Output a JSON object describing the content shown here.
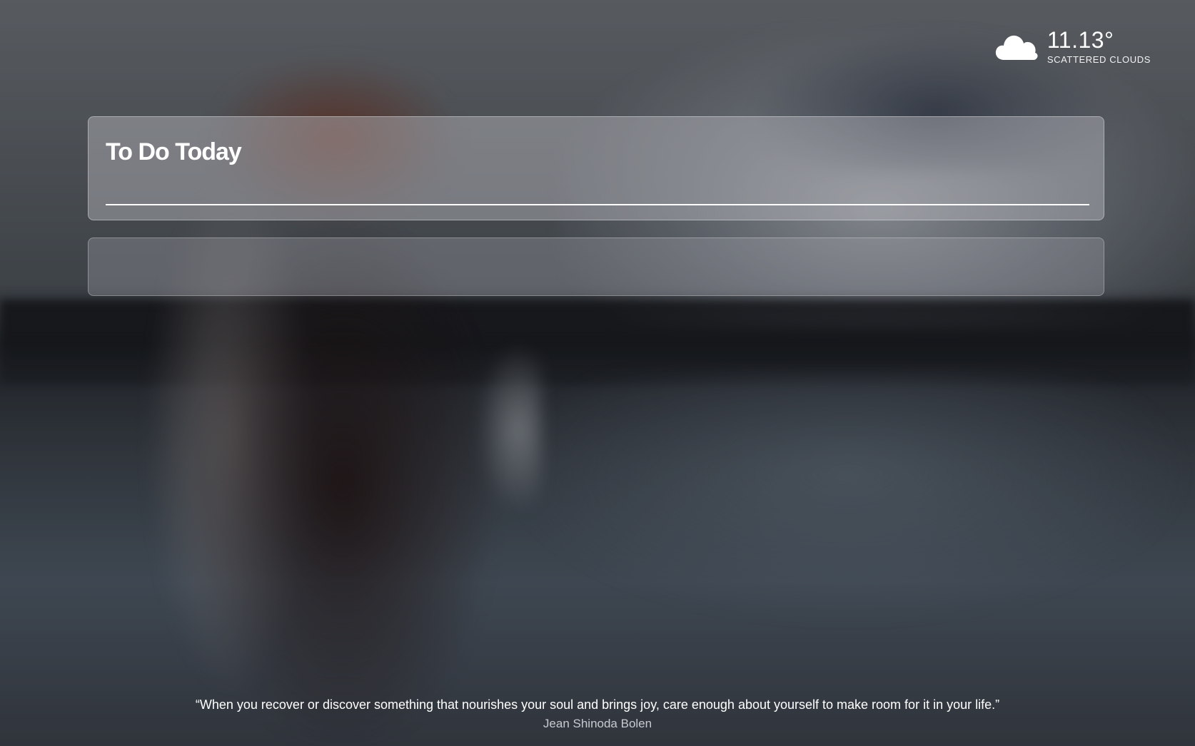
{
  "weather": {
    "icon": "cloud-icon",
    "temperature": "11.13°",
    "description": "SCATTERED CLOUDS"
  },
  "todo": {
    "title": "To Do Today",
    "input_value": "",
    "input_placeholder": ""
  },
  "quote": {
    "text": "“When you recover or discover something that nourishes your soul and brings joy, care enough about yourself to make room for it in your life.”",
    "author": "Jean Shinoda Bolen"
  }
}
